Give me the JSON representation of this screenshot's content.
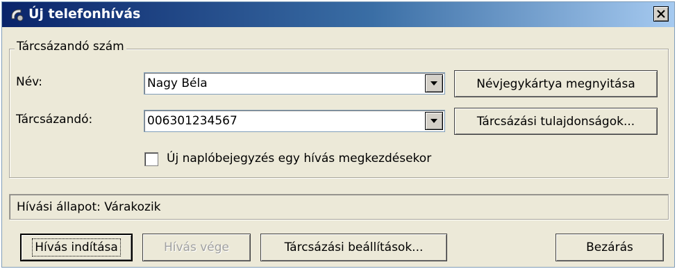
{
  "window": {
    "title": "Új telefonhívás",
    "close_symbol": "X"
  },
  "group": {
    "legend": "Tárcsázandó szám"
  },
  "fields": {
    "name_label": "Név:",
    "name_value": "Nagy Béla",
    "dial_label": "Tárcsázandó:",
    "dial_value": "006301234567"
  },
  "buttons": {
    "open_contact": "Névjegykártya megnyitása",
    "dial_properties": "Tárcsázási tulajdonságok...",
    "start_call": "Hívás indítása",
    "end_call": "Hívás vége",
    "dial_settings": "Tárcsázási beállítások...",
    "close": "Bezárás"
  },
  "checkbox": {
    "label": "Új naplóbejegyzés egy hívás megkezdésekor",
    "checked": false
  },
  "status": {
    "label": "Hívási állapot:",
    "value": "Várakozik"
  },
  "icons": {
    "title": "phone-icon",
    "dropdown": "chevron-down-icon",
    "close": "close-icon"
  },
  "colors": {
    "title_start": "#0a246a",
    "title_end": "#a6caf0",
    "face": "#ece9d8"
  }
}
